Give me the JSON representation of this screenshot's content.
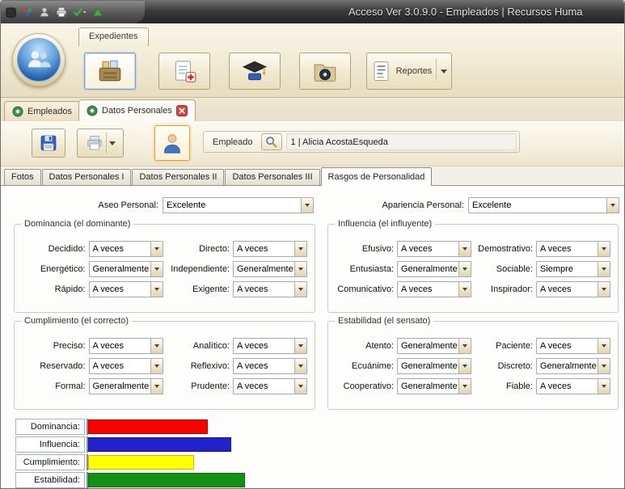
{
  "window": {
    "title": "Acceso  Ver 3.0.9.0 - Empleados | Recursos Huma",
    "titlebar_icons": [
      "app-icon",
      "people-group-icon",
      "user-icon",
      "printer-icon",
      "check-dropdown-icon",
      "triangle-up-icon"
    ]
  },
  "ribbon": {
    "tab_label": "Expedientes",
    "buttons": [
      {
        "name": "archivo",
        "icon": "archive-drawer-icon",
        "selected": true
      },
      {
        "name": "notas-medicas",
        "icon": "medical-notes-icon"
      },
      {
        "name": "formacion",
        "icon": "graduation-cap-icon"
      },
      {
        "name": "expediente",
        "icon": "folder-icon"
      },
      {
        "name": "reportes",
        "icon": "report-icon",
        "label": "Reportes",
        "has_dropdown": true
      }
    ]
  },
  "doc_tabs": {
    "tabs": [
      {
        "label": "Empleados",
        "active": false
      },
      {
        "label": "Datos Personales",
        "active": true,
        "closable": true
      }
    ]
  },
  "toolbar": {
    "save_icon": "save-icon",
    "print_icon": "printer-icon",
    "employee_button_icon": "person-icon",
    "search_icon": "search-icon",
    "employee_label": "Empleado",
    "employee_value": "1 | Alicia AcostaEsqueda"
  },
  "page_tabs": {
    "tabs": [
      "Fotos",
      "Datos Personales I",
      "Datos Personales II",
      "Datos Personales III",
      "Rasgos de Personalidad"
    ],
    "active_index": 4
  },
  "form": {
    "top_fields": [
      {
        "label": "Aseo Personal:",
        "value": "Excelente"
      },
      {
        "label": "Apariencia Personal:",
        "value": "Excelente"
      }
    ],
    "groups": [
      {
        "title": "Dominancia (el dominante)",
        "fields": [
          {
            "label": "Decidido:",
            "value": "A veces"
          },
          {
            "label": "Directo:",
            "value": "A veces"
          },
          {
            "label": "Energético:",
            "value": "Generalmente"
          },
          {
            "label": "Independiente:",
            "value": "Generalmente"
          },
          {
            "label": "Rápido:",
            "value": "A veces"
          },
          {
            "label": "Exigente:",
            "value": "A veces"
          }
        ]
      },
      {
        "title": "Influencia (el influyente)",
        "fields": [
          {
            "label": "Efusivo:",
            "value": "A veces"
          },
          {
            "label": "Demostrativo:",
            "value": "A veces"
          },
          {
            "label": "Entusiasta:",
            "value": "Generalmente"
          },
          {
            "label": "Sociable:",
            "value": "Siempre"
          },
          {
            "label": "Comunicativo:",
            "value": "A veces"
          },
          {
            "label": "Inspirador:",
            "value": "A veces"
          }
        ]
      },
      {
        "title": "Cumplimiento (el correcto)",
        "fields": [
          {
            "label": "Preciso:",
            "value": "A veces"
          },
          {
            "label": "Analítico:",
            "value": "A veces"
          },
          {
            "label": "Reservado:",
            "value": "A veces"
          },
          {
            "label": "Reflexivo:",
            "value": "A veces"
          },
          {
            "label": "Formal:",
            "value": "Generalmente"
          },
          {
            "label": "Prudente:",
            "value": "A veces"
          }
        ]
      },
      {
        "title": "Estabilidad (el sensato)",
        "fields": [
          {
            "label": "Atento:",
            "value": "Generalmente"
          },
          {
            "label": "Paciente:",
            "value": "A veces"
          },
          {
            "label": "Ecuánime:",
            "value": "Generalmente"
          },
          {
            "label": "Discreto:",
            "value": "Generalmente"
          },
          {
            "label": "Cooperativo:",
            "value": "Generalmente"
          },
          {
            "label": "Fiable:",
            "value": "A veces"
          }
        ]
      }
    ]
  },
  "chart_data": {
    "type": "bar",
    "orientation": "horizontal",
    "title": "",
    "categories": [
      "Dominancia:",
      "Influencia:",
      "Cumplimiento:",
      "Estabilidad:"
    ],
    "values": [
      26,
      31,
      23,
      34
    ],
    "xlim": [
      0,
      100
    ],
    "colors": [
      "#fe0000",
      "#2222cc",
      "#ffff00",
      "#129012"
    ],
    "grid": false,
    "legend": false
  }
}
